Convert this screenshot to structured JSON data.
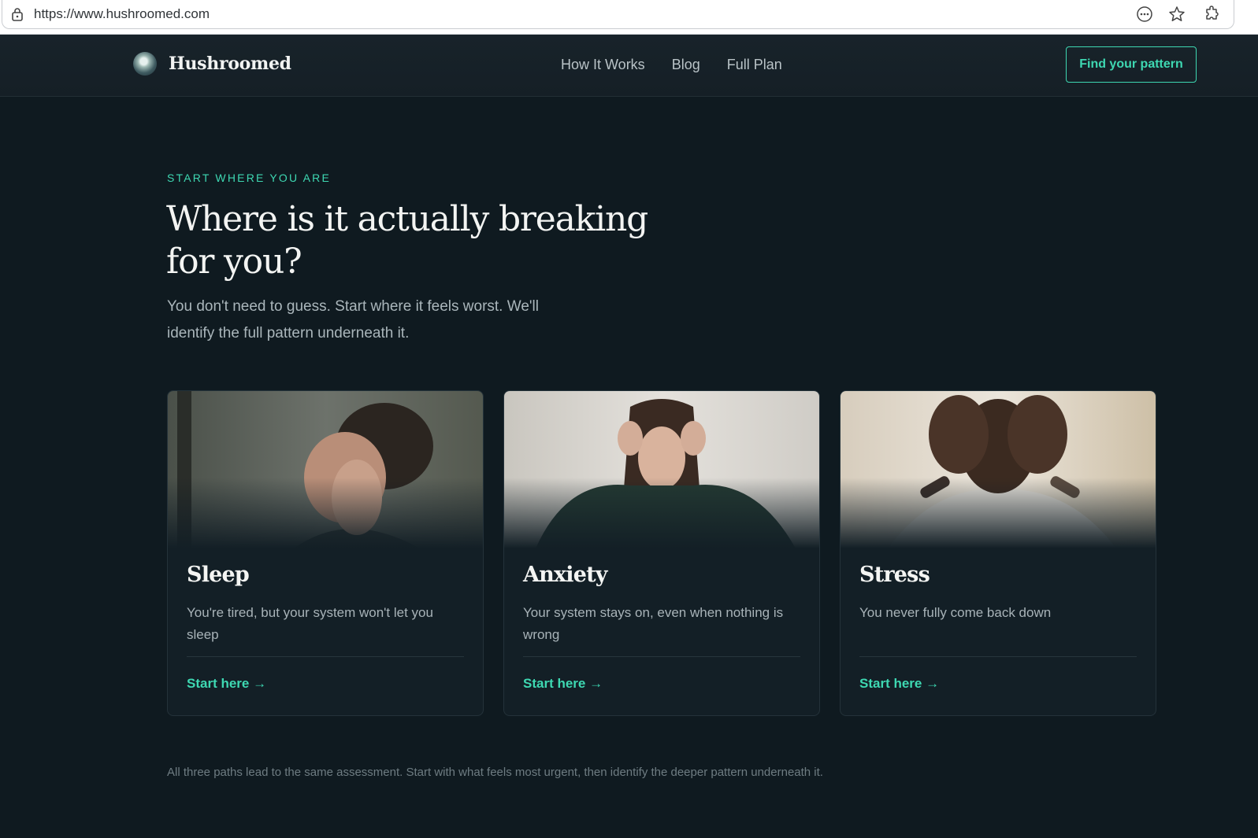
{
  "browser": {
    "url": "https://www.hushroomed.com",
    "icons": [
      "lock-icon",
      "more-icon",
      "star-icon",
      "extensions-icon"
    ]
  },
  "nav": {
    "brand": "Hushroomed",
    "links": [
      "How It Works",
      "Blog",
      "Full Plan"
    ],
    "cta": "Find your pattern"
  },
  "hero": {
    "eyebrow": "START WHERE YOU ARE",
    "headline": "Where is it actually breaking for you?",
    "subhead": "You don't need to guess. Start where it feels worst. We'll identify the full pattern underneath it."
  },
  "cards": [
    {
      "title": "Sleep",
      "description": "You're tired, but your system won't let you sleep",
      "link": "Start here →"
    },
    {
      "title": "Anxiety",
      "description": "Your system stays on, even when nothing is wrong",
      "link": "Start here →"
    },
    {
      "title": "Stress",
      "description": "You never fully come back down",
      "link": "Start here →"
    }
  ],
  "footnote": "All three paths lead to the same assessment. Start with what feels most urgent, then identify the deeper pattern underneath it.",
  "colors": {
    "accent": "#3ed8b2",
    "background": "#0f1a20",
    "card": "#131f26"
  }
}
